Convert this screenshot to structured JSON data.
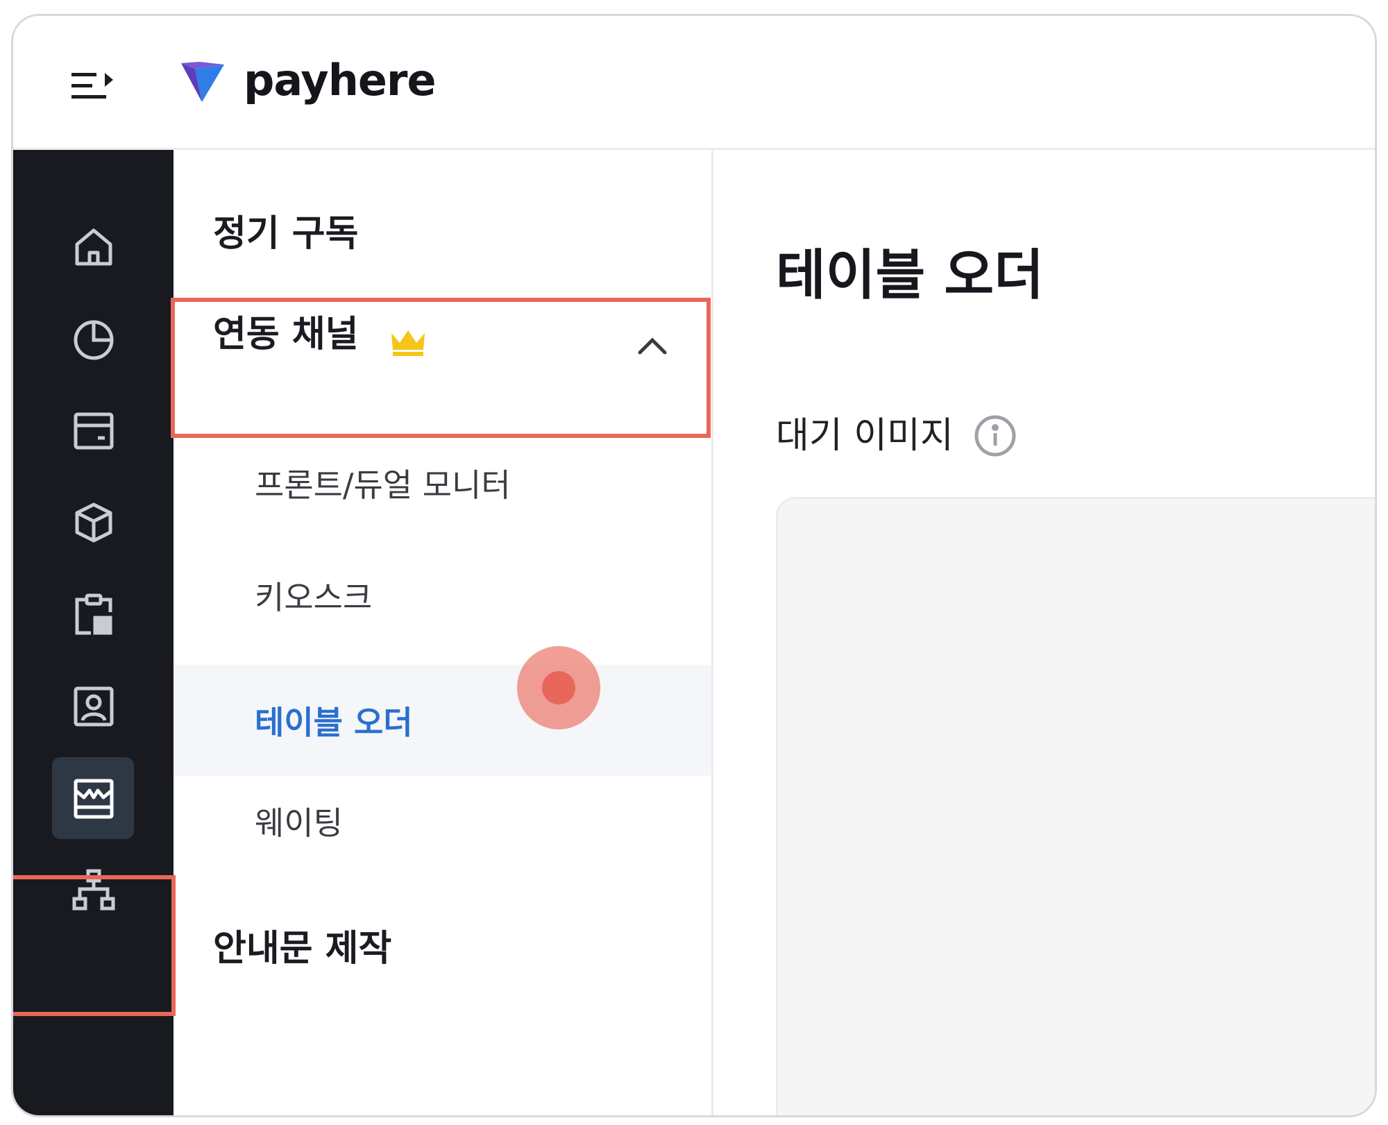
{
  "brand": {
    "name": "payhere"
  },
  "rail": {
    "items": [
      {
        "icon": "home-icon",
        "active": false
      },
      {
        "icon": "pie-chart-icon",
        "active": false
      },
      {
        "icon": "card-icon",
        "active": false
      },
      {
        "icon": "box-icon",
        "active": false
      },
      {
        "icon": "clipboard-icon",
        "active": false
      },
      {
        "icon": "contact-icon",
        "active": false
      },
      {
        "icon": "store-icon",
        "active": true
      },
      {
        "icon": "sitemap-icon",
        "active": false
      }
    ]
  },
  "submenu": {
    "section_subscription": "정기 구독",
    "section_channels": "연동 채널",
    "channel_items": [
      {
        "label": "프론트/듀얼 모니터",
        "selected": false
      },
      {
        "label": "키오스크",
        "selected": false
      },
      {
        "label": "테이블 오더",
        "selected": true
      },
      {
        "label": "웨이팅",
        "selected": false
      }
    ],
    "section_notice": "안내문 제작"
  },
  "main": {
    "title": "테이블 오더",
    "field_label": "대기 이미지"
  },
  "colors": {
    "rail_bg": "#181a20",
    "accent_blue": "#2a6fcf",
    "highlight": "#e8675a",
    "crown": "#f5c518"
  }
}
